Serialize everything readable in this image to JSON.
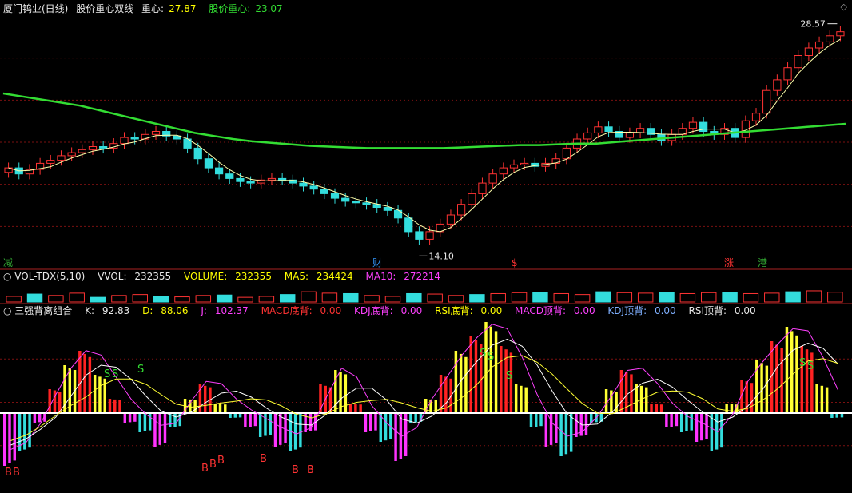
{
  "header": {
    "stock": "厦门钨业(日线)",
    "indicator": "股价重心双线",
    "center_label": "重心:",
    "center_value": "27.87",
    "price_center_label": "股价重心:",
    "price_center_value": "23.07",
    "corner_icon": "diamond-icon"
  },
  "price_panel": {
    "high_label": "28.57",
    "low_label": "14.10",
    "markers": [
      "减",
      "财",
      "$",
      "涨",
      "港"
    ],
    "colors": {
      "up": "#ff3333",
      "down": "#33dddd",
      "ma_long": "#33dd33",
      "ma_short": "#ffffaa"
    }
  },
  "volume_panel": {
    "name": "VOL-TDX(5,10)",
    "vvol_label": "VVOL:",
    "vvol_value": "232355",
    "volume_label": "VOLUME:",
    "volume_value": "232355",
    "ma5_label": "MA5:",
    "ma5_value": "234424",
    "ma10_label": "MA10:",
    "ma10_value": "272214"
  },
  "kdj_panel": {
    "name": "三强背离组合",
    "k_label": "K:",
    "k_value": "92.83",
    "d_label": "D:",
    "d_value": "88.06",
    "j_label": "J:",
    "j_value": "102.37",
    "macd_bottom_label": "MACD底背:",
    "macd_bottom_value": "0.00",
    "kdj_bottom_label": "KDJ底背:",
    "kdj_bottom_value": "0.00",
    "rsi_bottom_label": "RSI底背:",
    "rsi_bottom_value": "0.00",
    "macd_top_label": "MACD顶背:",
    "macd_top_value": "0.00",
    "kdj_top_label": "KDJ顶背:",
    "kdj_top_value": "0.00",
    "rsi_top_label": "RSI顶背:",
    "rsi_top_value": "0.00",
    "signal_letters": {
      "buy": "B",
      "sell": "S"
    }
  },
  "chart_data": {
    "type": "candlestick",
    "close": [
      19.6,
      19.2,
      19.5,
      19.9,
      20.1,
      20.4,
      20.6,
      20.8,
      21.0,
      20.9,
      21.2,
      21.6,
      21.5,
      21.8,
      22.0,
      21.7,
      21.5,
      20.9,
      20.2,
      19.6,
      19.2,
      18.9,
      18.7,
      18.6,
      18.8,
      18.9,
      18.8,
      18.6,
      18.4,
      18.2,
      17.9,
      17.6,
      17.4,
      17.3,
      17.2,
      17.0,
      16.8,
      16.3,
      15.4,
      14.9,
      15.4,
      15.9,
      16.5,
      17.2,
      17.9,
      18.6,
      19.2,
      19.6,
      19.8,
      19.9,
      19.7,
      19.9,
      20.2,
      20.9,
      21.5,
      21.9,
      22.3,
      22.0,
      21.6,
      21.9,
      22.2,
      21.8,
      21.4,
      21.8,
      22.2,
      22.6,
      22.0,
      21.8,
      22.2,
      21.6,
      22.7,
      23.2,
      24.7,
      25.4,
      26.2,
      27.0,
      27.5,
      27.9,
      28.3,
      28.57
    ],
    "ma_long": [
      24.5,
      24.3,
      24.1,
      23.9,
      23.7,
      23.4,
      23.1,
      22.8,
      22.5,
      22.2,
      21.9,
      21.7,
      21.5,
      21.35,
      21.25,
      21.15,
      21.05,
      21.0,
      20.95,
      20.9,
      20.9,
      20.9,
      20.9,
      20.9,
      20.95,
      21.0,
      21.05,
      21.1,
      21.1,
      21.15,
      21.2,
      21.2,
      21.3,
      21.4,
      21.5,
      21.6,
      21.7,
      21.8,
      21.9,
      22.0,
      22.1,
      22.2,
      22.3,
      22.4,
      22.5
    ],
    "volume": [
      0.6,
      0.85,
      0.7,
      0.95,
      0.5,
      0.7,
      0.8,
      0.6,
      0.55,
      0.7,
      0.75,
      0.5,
      0.6,
      0.8,
      1.1,
      0.95,
      0.9,
      0.7,
      0.6,
      0.9,
      0.85,
      0.7,
      0.8,
      0.9,
      1.0,
      1.05,
      0.9,
      0.8,
      1.1,
      1.0,
      0.95,
      1.0,
      0.9,
      1.0,
      1.0,
      0.9,
      0.95,
      1.1,
      1.2,
      1.05
    ],
    "kdj_bars": [
      -55,
      -40,
      -10,
      25,
      50,
      65,
      40,
      15,
      -10,
      -20,
      -35,
      -15,
      15,
      30,
      10,
      -5,
      -15,
      -25,
      -35,
      -40,
      -20,
      30,
      45,
      10,
      -20,
      -30,
      -50,
      -10,
      15,
      40,
      65,
      80,
      95,
      70,
      30,
      -15,
      -35,
      -45,
      -25,
      -10,
      25,
      45,
      30,
      10,
      -15,
      -20,
      -30,
      -40,
      10,
      35,
      55,
      75,
      90,
      70,
      30,
      -5
    ]
  }
}
